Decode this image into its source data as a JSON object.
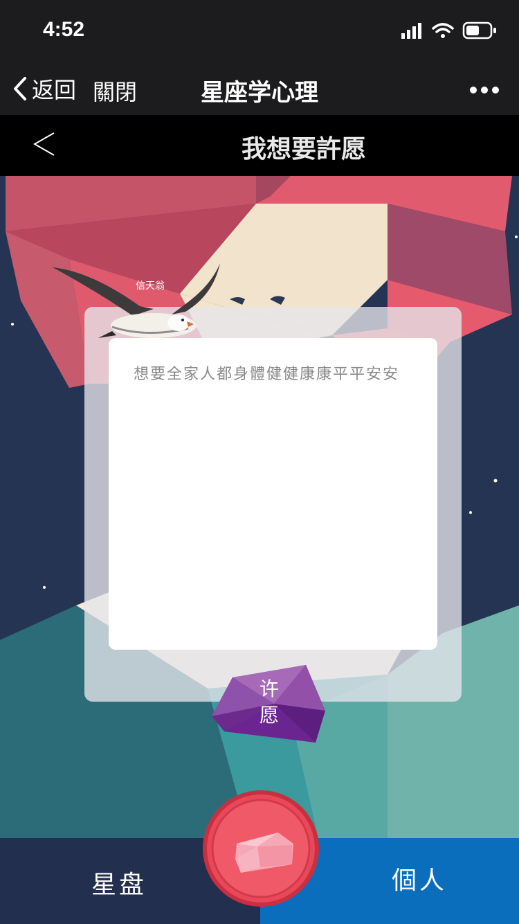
{
  "status_bar": {
    "time": "4:52"
  },
  "nav_bar": {
    "back_label": "返回",
    "close_label": "關閉",
    "title": "星座学心理"
  },
  "sub_header": {
    "title": "我想要許愿"
  },
  "bird": {
    "label": "信天翁"
  },
  "wish": {
    "text": "想要全家人都身體健健康康平平安安",
    "button_line1": "许",
    "button_line2": "愿"
  },
  "tab_bar": {
    "left_label": "星盘",
    "right_label": "個人"
  },
  "icons": [
    "signal-icon",
    "wifi-icon",
    "battery-icon",
    "chevron-left-icon",
    "more-icon",
    "gem-icon"
  ],
  "colors": {
    "tab_left": "#232f4e",
    "tab_right": "#0a6ebd",
    "center_button": "#e8485a",
    "wish_button": "#7a3d9c"
  }
}
